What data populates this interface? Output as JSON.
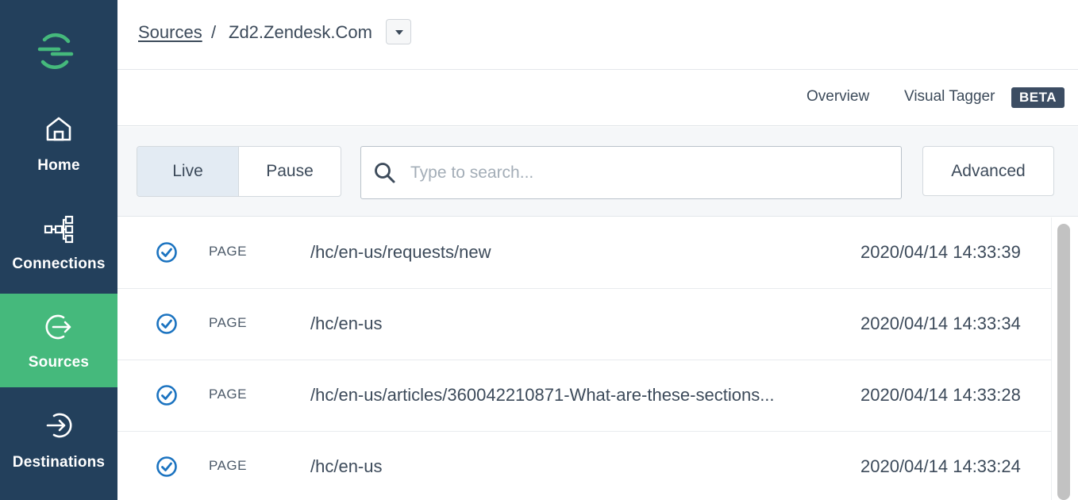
{
  "sidebar": {
    "logo": "segment-logo",
    "items": [
      {
        "label": "Home",
        "icon": "home-icon",
        "active": false
      },
      {
        "label": "Connections",
        "icon": "connections-icon",
        "active": false
      },
      {
        "label": "Sources",
        "icon": "sources-icon",
        "active": true
      },
      {
        "label": "Destinations",
        "icon": "destinations-icon",
        "active": false
      }
    ]
  },
  "header": {
    "breadcrumb_link": "Sources",
    "separator": "/",
    "current": "Zd2.Zendesk.Com"
  },
  "tabs": {
    "overview": "Overview",
    "visual_tagger": "Visual Tagger",
    "beta_badge": "BETA"
  },
  "toolbar": {
    "live_label": "Live",
    "pause_label": "Pause",
    "search_placeholder": "Type to search...",
    "search_value": "",
    "advanced_label": "Advanced"
  },
  "events": [
    {
      "type": "PAGE",
      "path": "/hc/en-us/requests/new",
      "time": "2020/04/14 14:33:39"
    },
    {
      "type": "PAGE",
      "path": "/hc/en-us",
      "time": "2020/04/14 14:33:34"
    },
    {
      "type": "PAGE",
      "path": "/hc/en-us/articles/360042210871-What-are-these-sections...",
      "time": "2020/04/14 14:33:28"
    },
    {
      "type": "PAGE",
      "path": "/hc/en-us",
      "time": "2020/04/14 14:33:24"
    }
  ],
  "colors": {
    "sidebar_bg": "#23405c",
    "active_nav": "#45b97c",
    "check_blue": "#1b73c0",
    "beta_bg": "#3c4d63"
  }
}
